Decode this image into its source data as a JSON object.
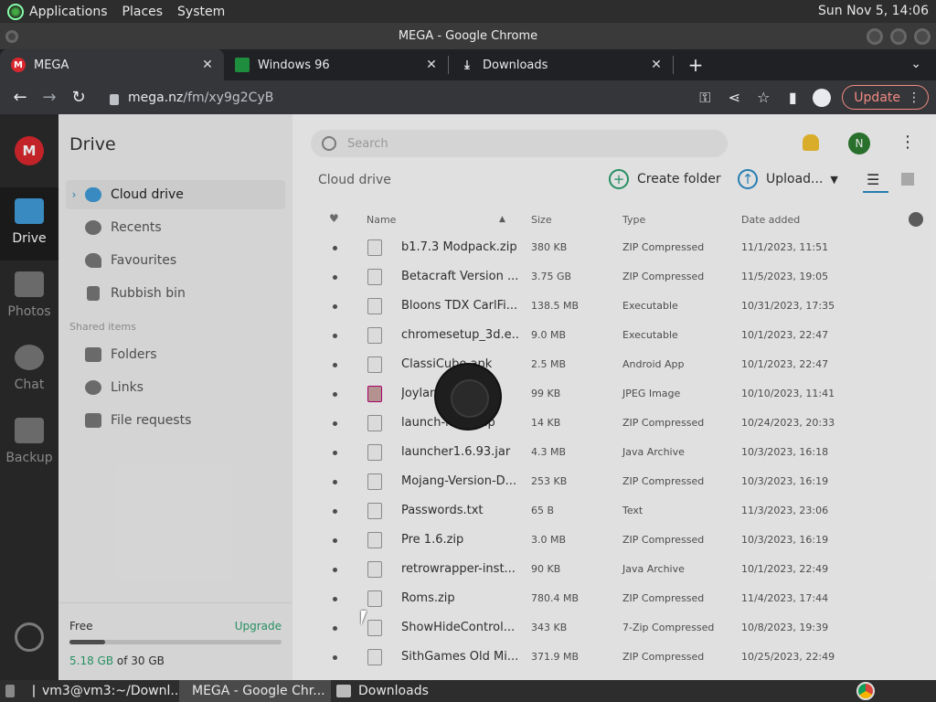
{
  "panel": {
    "menus": [
      "Applications",
      "Places",
      "System"
    ],
    "clock": "Sun Nov  5, 14:06"
  },
  "window": {
    "title": "MEGA - Google Chrome"
  },
  "tabs": [
    {
      "label": "MEGA",
      "icon": "mega-logo-icon",
      "color": "#d9272e"
    },
    {
      "label": "Windows 96",
      "icon": "windows96-icon",
      "color": "#1e8e3e"
    },
    {
      "label": "Downloads",
      "icon": "download-icon",
      "color": "#e8eaed"
    }
  ],
  "toolbar": {
    "url_host": "mega.nz",
    "url_path": "/fm/xy9g2CyB",
    "update_label": "Update"
  },
  "leftbar": {
    "logo": "M",
    "items": [
      {
        "label": "Drive",
        "icon": "folder-icon"
      },
      {
        "label": "Photos",
        "icon": "photos-icon"
      },
      {
        "label": "Chat",
        "icon": "chat-icon"
      },
      {
        "label": "Backup",
        "icon": "backup-icon"
      }
    ]
  },
  "sidebar": {
    "title": "Drive",
    "items": [
      {
        "label": "Cloud drive",
        "icon": "cloud-icon"
      },
      {
        "label": "Recents",
        "icon": "clock-icon"
      },
      {
        "label": "Favourites",
        "icon": "heart-icon"
      },
      {
        "label": "Rubbish bin",
        "icon": "trash-icon"
      }
    ],
    "shared_heading": "Shared items",
    "shared_items": [
      {
        "label": "Folders",
        "icon": "shared-folder-icon"
      },
      {
        "label": "Links",
        "icon": "link-icon"
      },
      {
        "label": "File requests",
        "icon": "file-request-icon"
      }
    ],
    "storage": {
      "free_label": "Free",
      "upgrade_label": "Upgrade",
      "used": "5.18 GB",
      "total": " of 30 GB",
      "fraction": 0.17
    }
  },
  "main": {
    "search_placeholder": "Search",
    "avatar_initial": "N",
    "breadcrumb": "Cloud drive",
    "create_folder": "Create folder",
    "upload": "Upload...",
    "columns": {
      "name": "Name",
      "size": "Size",
      "type": "Type",
      "date": "Date added"
    },
    "files": [
      {
        "name": "b1.7.3 Modpack.zip",
        "size": "380 KB",
        "type": "ZIP Compressed",
        "date": "11/1/2023, 11:51",
        "icon": "zip-icon"
      },
      {
        "name": "Betacraft Version ...",
        "size": "3.75 GB",
        "type": "ZIP Compressed",
        "date": "11/5/2023, 19:05",
        "icon": "zip-icon"
      },
      {
        "name": "Bloons TDX CarlFi...",
        "size": "138.5 MB",
        "type": "Executable",
        "date": "10/31/2023, 17:35",
        "icon": "executable-icon"
      },
      {
        "name": "chromesetup_3d.e...",
        "size": "9.0 MB",
        "type": "Executable",
        "date": "10/1/2023, 22:47",
        "icon": "executable-icon"
      },
      {
        "name": "ClassiCube.apk",
        "size": "2.5 MB",
        "type": "Android App",
        "date": "10/1/2023, 22:47",
        "icon": "android-icon"
      },
      {
        "name": "Joylan",
        "size": "99 KB",
        "type": "JPEG Image",
        "date": "10/10/2023, 11:41",
        "icon": "image-icon"
      },
      {
        "name": "launch-m...s.zip",
        "size": "14 KB",
        "type": "ZIP Compressed",
        "date": "10/24/2023, 20:33",
        "icon": "zip-icon"
      },
      {
        "name": "launcher1.6.93.jar",
        "size": "4.3 MB",
        "type": "Java Archive",
        "date": "10/3/2023, 16:18",
        "icon": "java-icon"
      },
      {
        "name": "Mojang-Version-D...",
        "size": "253 KB",
        "type": "ZIP Compressed",
        "date": "10/3/2023, 16:19",
        "icon": "zip-icon"
      },
      {
        "name": "Passwords.txt",
        "size": "65 B",
        "type": "Text",
        "date": "11/3/2023, 23:06",
        "icon": "text-icon"
      },
      {
        "name": "Pre 1.6.zip",
        "size": "3.0 MB",
        "type": "ZIP Compressed",
        "date": "10/3/2023, 16:19",
        "icon": "zip-icon"
      },
      {
        "name": "retrowrapper-inst...",
        "size": "90 KB",
        "type": "Java Archive",
        "date": "10/1/2023, 22:49",
        "icon": "java-icon"
      },
      {
        "name": "Roms.zip",
        "size": "780.4 MB",
        "type": "ZIP Compressed",
        "date": "11/4/2023, 17:44",
        "icon": "zip-icon"
      },
      {
        "name": "ShowHideControl...",
        "size": "343 KB",
        "type": "7-Zip Compressed",
        "date": "10/8/2023, 19:39",
        "icon": "7zip-icon"
      },
      {
        "name": "SithGames Old Mi...",
        "size": "371.9 MB",
        "type": "ZIP Compressed",
        "date": "10/25/2023, 22:49",
        "icon": "zip-icon"
      }
    ]
  },
  "taskbar": [
    {
      "label": "vm3@vm3:~/Downl...",
      "icon": "terminal-icon"
    },
    {
      "label": "MEGA - Google Chr...",
      "icon": "chrome-icon"
    },
    {
      "label": "Downloads",
      "icon": "folder-icon"
    }
  ]
}
